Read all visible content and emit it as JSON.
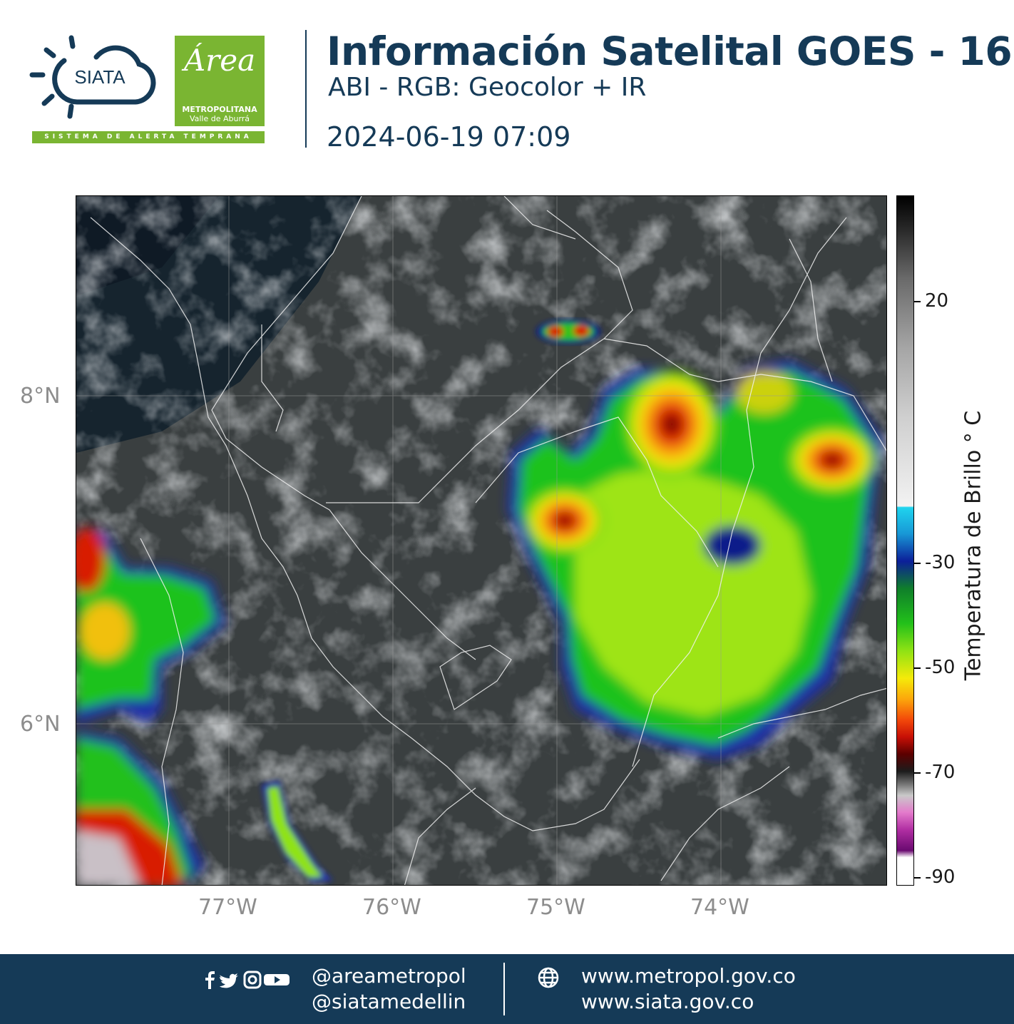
{
  "header": {
    "siata_logo_text": "SIATA",
    "siata_tagline": "SISTEMA DE ALERTA TEMPRANA",
    "area_logo": {
      "word": "Área",
      "line1": "METROPOLITANA",
      "line2": "Valle de Aburrá"
    },
    "title": "Información Satelital GOES - 16",
    "subtitle": "ABI - RGB: Geocolor + IR",
    "timestamp": "2024-06-19 07:09"
  },
  "map": {
    "lat_labels": [
      "8°N",
      "6°N"
    ],
    "lon_labels": [
      "77°W",
      "76°W",
      "75°W",
      "74°W"
    ]
  },
  "colorbar": {
    "title": "Temperatura de Brillo ° C",
    "tick_labels": [
      "20",
      "-30",
      "-50",
      "-70",
      "-90"
    ]
  },
  "footer": {
    "social_icons": [
      "facebook-icon",
      "twitter-icon",
      "instagram-icon",
      "youtube-icon"
    ],
    "handle1": "@areametropol",
    "handle2": "@siatamedellin",
    "web_icon": "globe-icon",
    "url1": "www.metropol.gov.co",
    "url2": "www.siata.gov.co"
  },
  "colors": {
    "navy": "#153a57",
    "green": "#7ab532"
  }
}
